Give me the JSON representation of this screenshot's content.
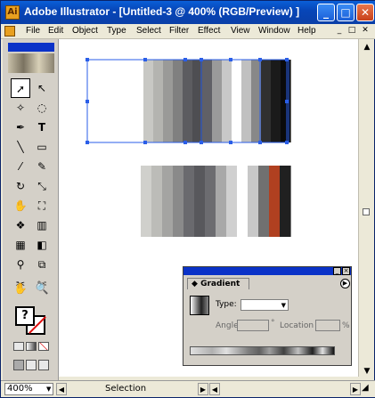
{
  "window": {
    "title": "Adobe Illustrator - [Untitled-3 @ 400% (RGB/Preview) ]",
    "minimize": "_",
    "maximize": "□",
    "close": "✕"
  },
  "menu": {
    "items": [
      "File",
      "Edit",
      "Object",
      "Type",
      "Select",
      "Filter",
      "Effect",
      "View",
      "Window",
      "Help"
    ],
    "doc_controls": [
      "_",
      "□",
      "✕"
    ]
  },
  "status": {
    "zoom": "400%",
    "tool": "Selection"
  },
  "gradient_panel": {
    "tab": "Gradient",
    "type_label": "Type:",
    "angle_label": "Angle",
    "angle_unit": "°",
    "location_label": "Location",
    "location_unit": "%"
  },
  "artwork": {
    "top_band": [
      "#c8c8c4",
      "#b4b4b0",
      "#9a9a98",
      "#808080",
      "#5c5c60",
      "#4e4e52",
      "#606066",
      "#9a9a9a",
      "#c8c8c8",
      "#ffffff",
      "#c0c0c0",
      "#888888",
      "#303030",
      "#1a1a1a",
      "#0a0a0a"
    ],
    "bottom_band": [
      "#d0d0cc",
      "#bcbcb8",
      "#a4a4a2",
      "#8a8a8a",
      "#6a6a6e",
      "#58585c",
      "#6c6c70",
      "#a8a8a8",
      "#d0d0d0",
      "#ffffff",
      "#c8c8c8",
      "#707070",
      "#b04020",
      "#202020"
    ]
  },
  "colors": {
    "selection": "#2a5ee8",
    "title_bar": "#0a5fd8",
    "close_button": "#e8764c"
  }
}
